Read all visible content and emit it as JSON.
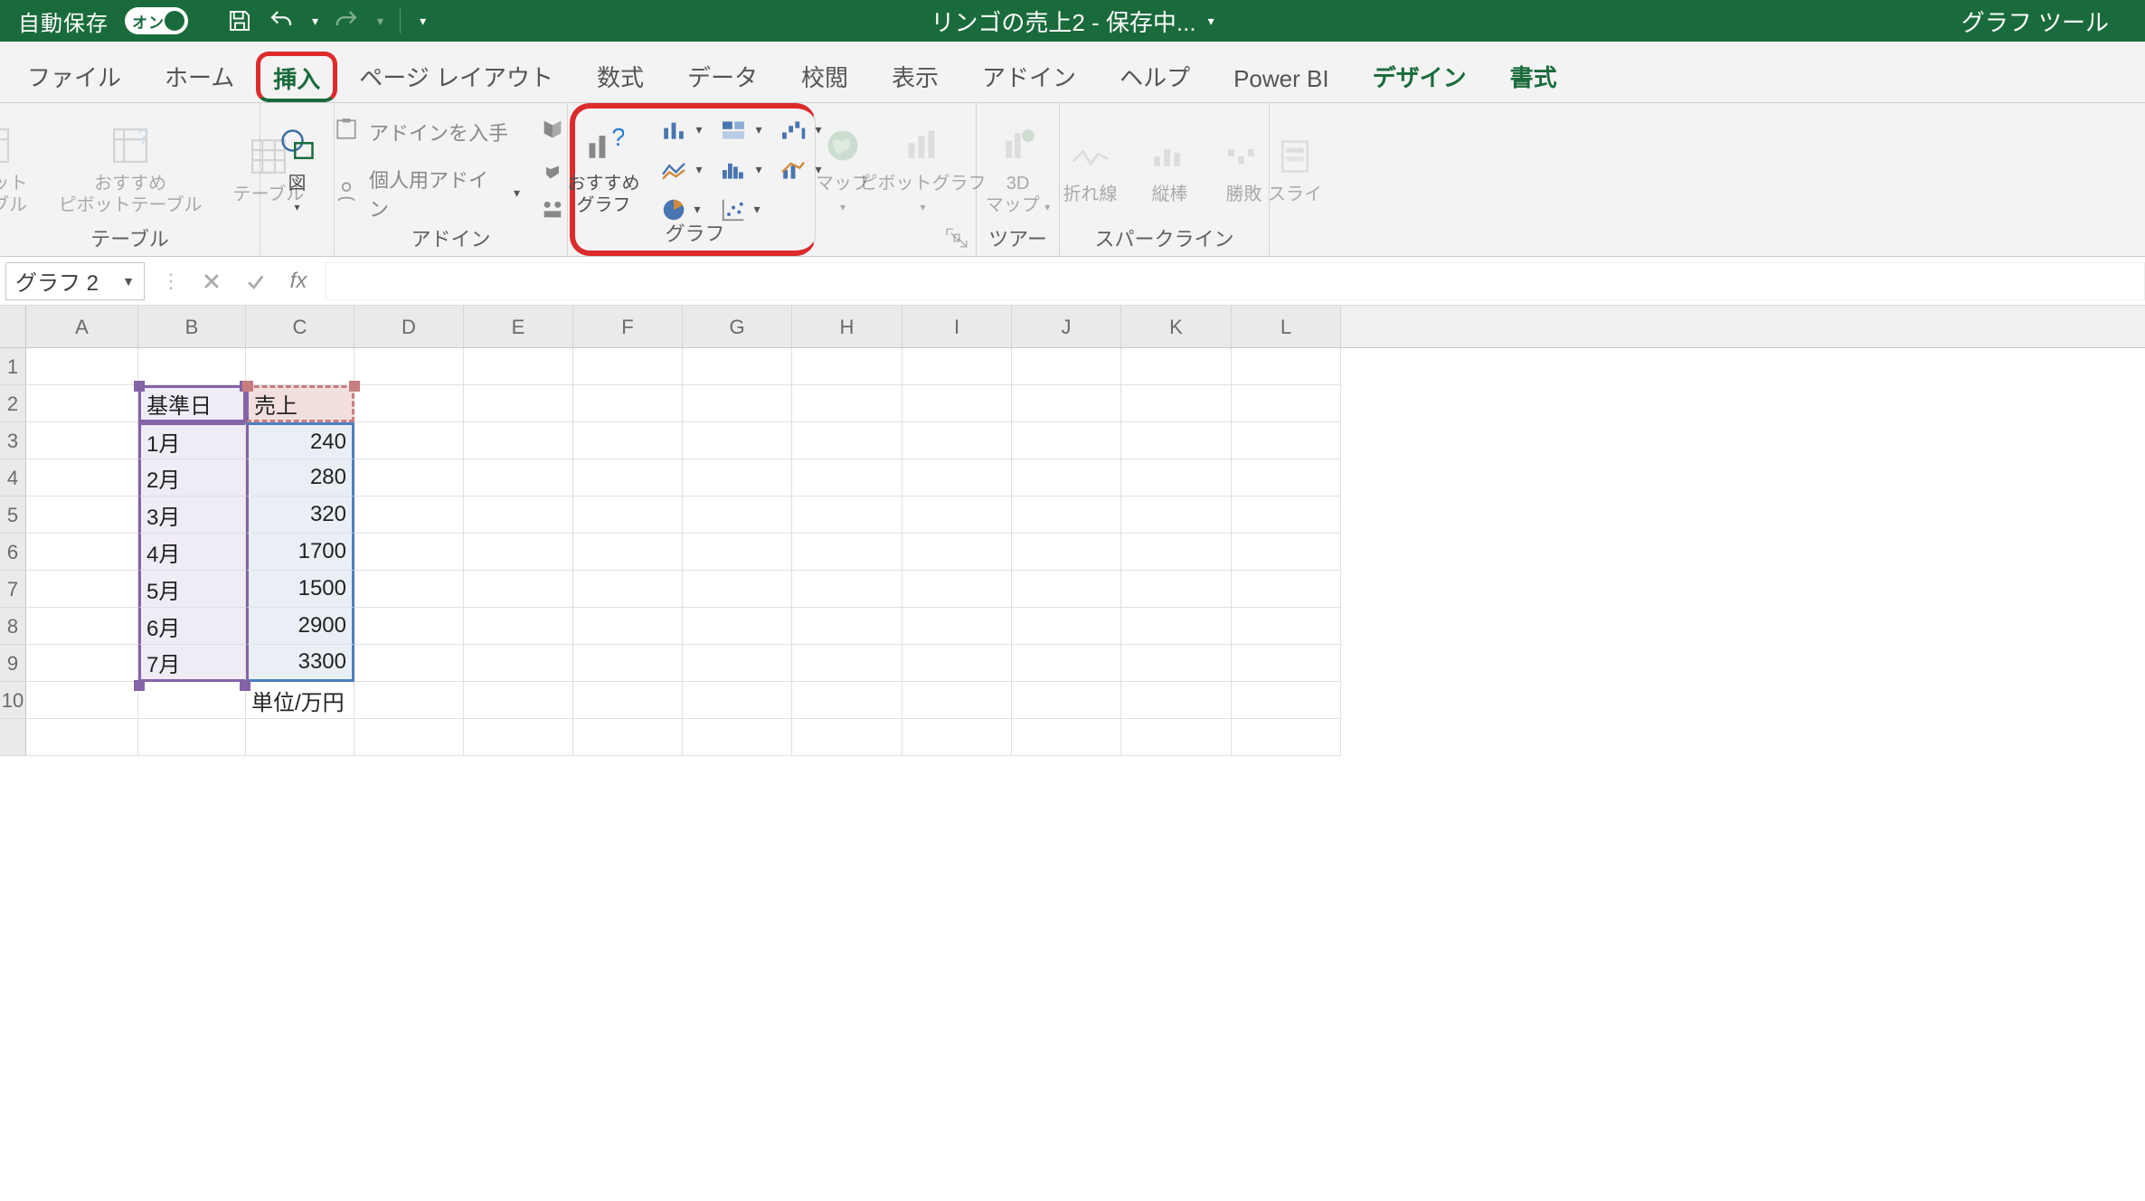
{
  "titlebar": {
    "autosave_label": "自動保存",
    "toggle_text": "オン",
    "doc_title": "リンゴの売上2 - 保存中...",
    "chart_tools": "グラフ ツール"
  },
  "tabs": {
    "file": "ファイル",
    "home": "ホーム",
    "insert": "挿入",
    "page_layout": "ページ レイアウト",
    "formulas": "数式",
    "data": "データ",
    "review": "校閲",
    "view": "表示",
    "addins": "アドイン",
    "help": "ヘルプ",
    "powerbi": "Power BI",
    "design": "デザイン",
    "format": "書式"
  },
  "ribbon": {
    "tables": {
      "pivot": "ピボット\nテーブル",
      "rec_pivot": "おすすめ\nピボットテーブル",
      "table": "テーブル",
      "group": "テーブル"
    },
    "illus": {
      "shapes": "図"
    },
    "addins": {
      "get": "アドインを入手",
      "my": "個人用アドイン",
      "group": "アドイン"
    },
    "charts": {
      "rec": "おすすめ\nグラフ",
      "maps": "マップ",
      "pivot_chart": "ピボットグラフ",
      "group": "グラフ"
    },
    "tours": {
      "map3d": "3D\nマップ",
      "group": "ツアー"
    },
    "spark": {
      "line": "折れ線",
      "column": "縦棒",
      "winloss": "勝敗",
      "group": "スパークライン"
    },
    "slicer": "スライ"
  },
  "fbar": {
    "namebox": "グラフ 2",
    "formula": ""
  },
  "columns": [
    "A",
    "B",
    "C",
    "D",
    "E",
    "F",
    "G",
    "H",
    "I",
    "J",
    "K",
    "L"
  ],
  "rows": [
    "1",
    "2",
    "3",
    "4",
    "5",
    "6",
    "7",
    "8",
    "9",
    "10"
  ],
  "data": {
    "b2": "基準日",
    "c2": "売上",
    "b3": "1月",
    "c3": "240",
    "b4": "2月",
    "c4": "280",
    "b5": "3月",
    "c5": "320",
    "b6": "4月",
    "c6": "1700",
    "b7": "5月",
    "c7": "1500",
    "b8": "6月",
    "c8": "2900",
    "b9": "7月",
    "c9": "3300",
    "c10": "単位/万円"
  },
  "chart_data": {
    "type": "table",
    "title": "リンゴの売上2",
    "columns": [
      "基準日",
      "売上"
    ],
    "rows": [
      [
        "1月",
        240
      ],
      [
        "2月",
        280
      ],
      [
        "3月",
        320
      ],
      [
        "4月",
        1700
      ],
      [
        "5月",
        1500
      ],
      [
        "6月",
        2900
      ],
      [
        "7月",
        3300
      ]
    ],
    "note": "単位/万円"
  }
}
